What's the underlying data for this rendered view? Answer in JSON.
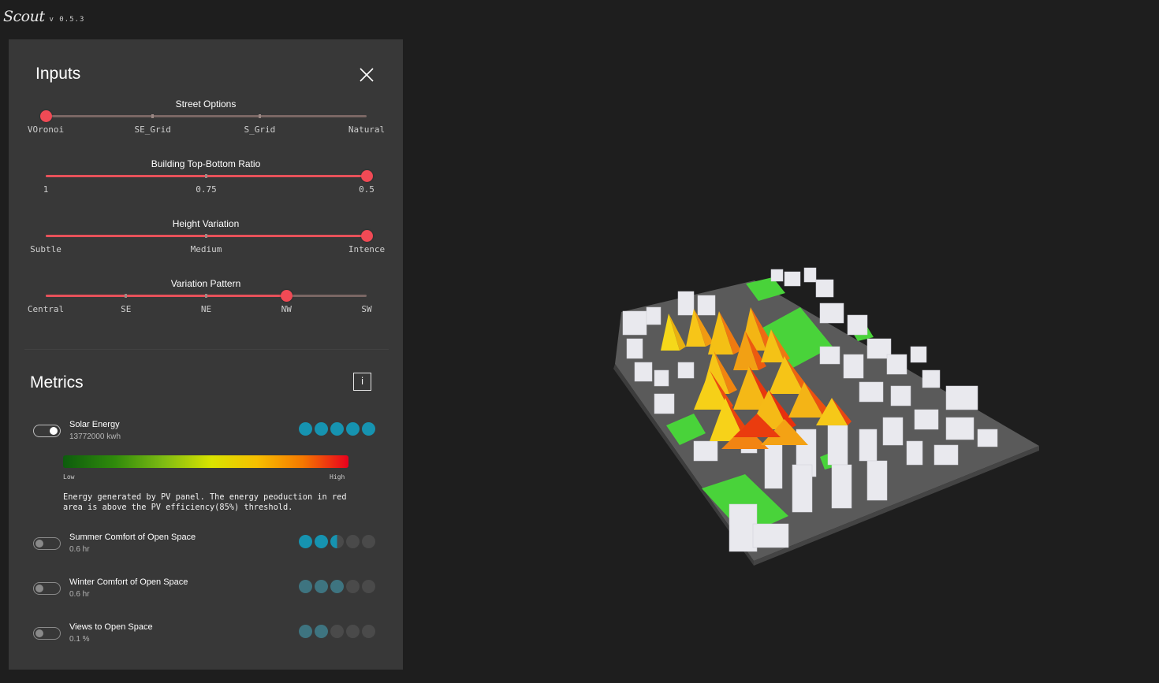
{
  "app": {
    "name": "Scout",
    "version": "v 0.5.3"
  },
  "inputs": {
    "title": "Inputs",
    "sliders": [
      {
        "label": "Street Options",
        "ticks": [
          "VOronoi",
          "SE_Grid",
          "S_Grid",
          "Natural"
        ],
        "value_index": 0
      },
      {
        "label": "Building Top-Bottom Ratio",
        "ticks": [
          "1",
          "0.75",
          "0.5"
        ],
        "value_index": 2
      },
      {
        "label": "Height Variation",
        "ticks": [
          "Subtle",
          "Medium",
          "Intence"
        ],
        "value_index": 2
      },
      {
        "label": "Variation Pattern",
        "ticks": [
          "Central",
          "SE",
          "NE",
          "NW",
          "SW"
        ],
        "value_index": 3
      }
    ]
  },
  "metrics": {
    "title": "Metrics",
    "info_label": "i",
    "items": [
      {
        "name": "Solar Energy",
        "value": "13772000 kwh",
        "enabled": true,
        "rating": 5
      },
      {
        "name": "Summer Comfort of Open Space",
        "value": "0.6 hr",
        "enabled": false,
        "rating": 2.5
      },
      {
        "name": "Winter Comfort of Open Space",
        "value": "0.6 hr",
        "enabled": false,
        "rating": 3
      },
      {
        "name": "Views to Open Space",
        "value": "0.1 %",
        "enabled": false,
        "rating": 2
      }
    ],
    "legend": {
      "low": "Low",
      "high": "High"
    },
    "description": "Energy generated by PV panel. The energy peoduction in red area is above the PV efficiency(85%) threshold."
  },
  "colors": {
    "accent": "#f04a55",
    "rating": "#1693b0",
    "panel": "#383838",
    "background": "#1e1e1e"
  }
}
